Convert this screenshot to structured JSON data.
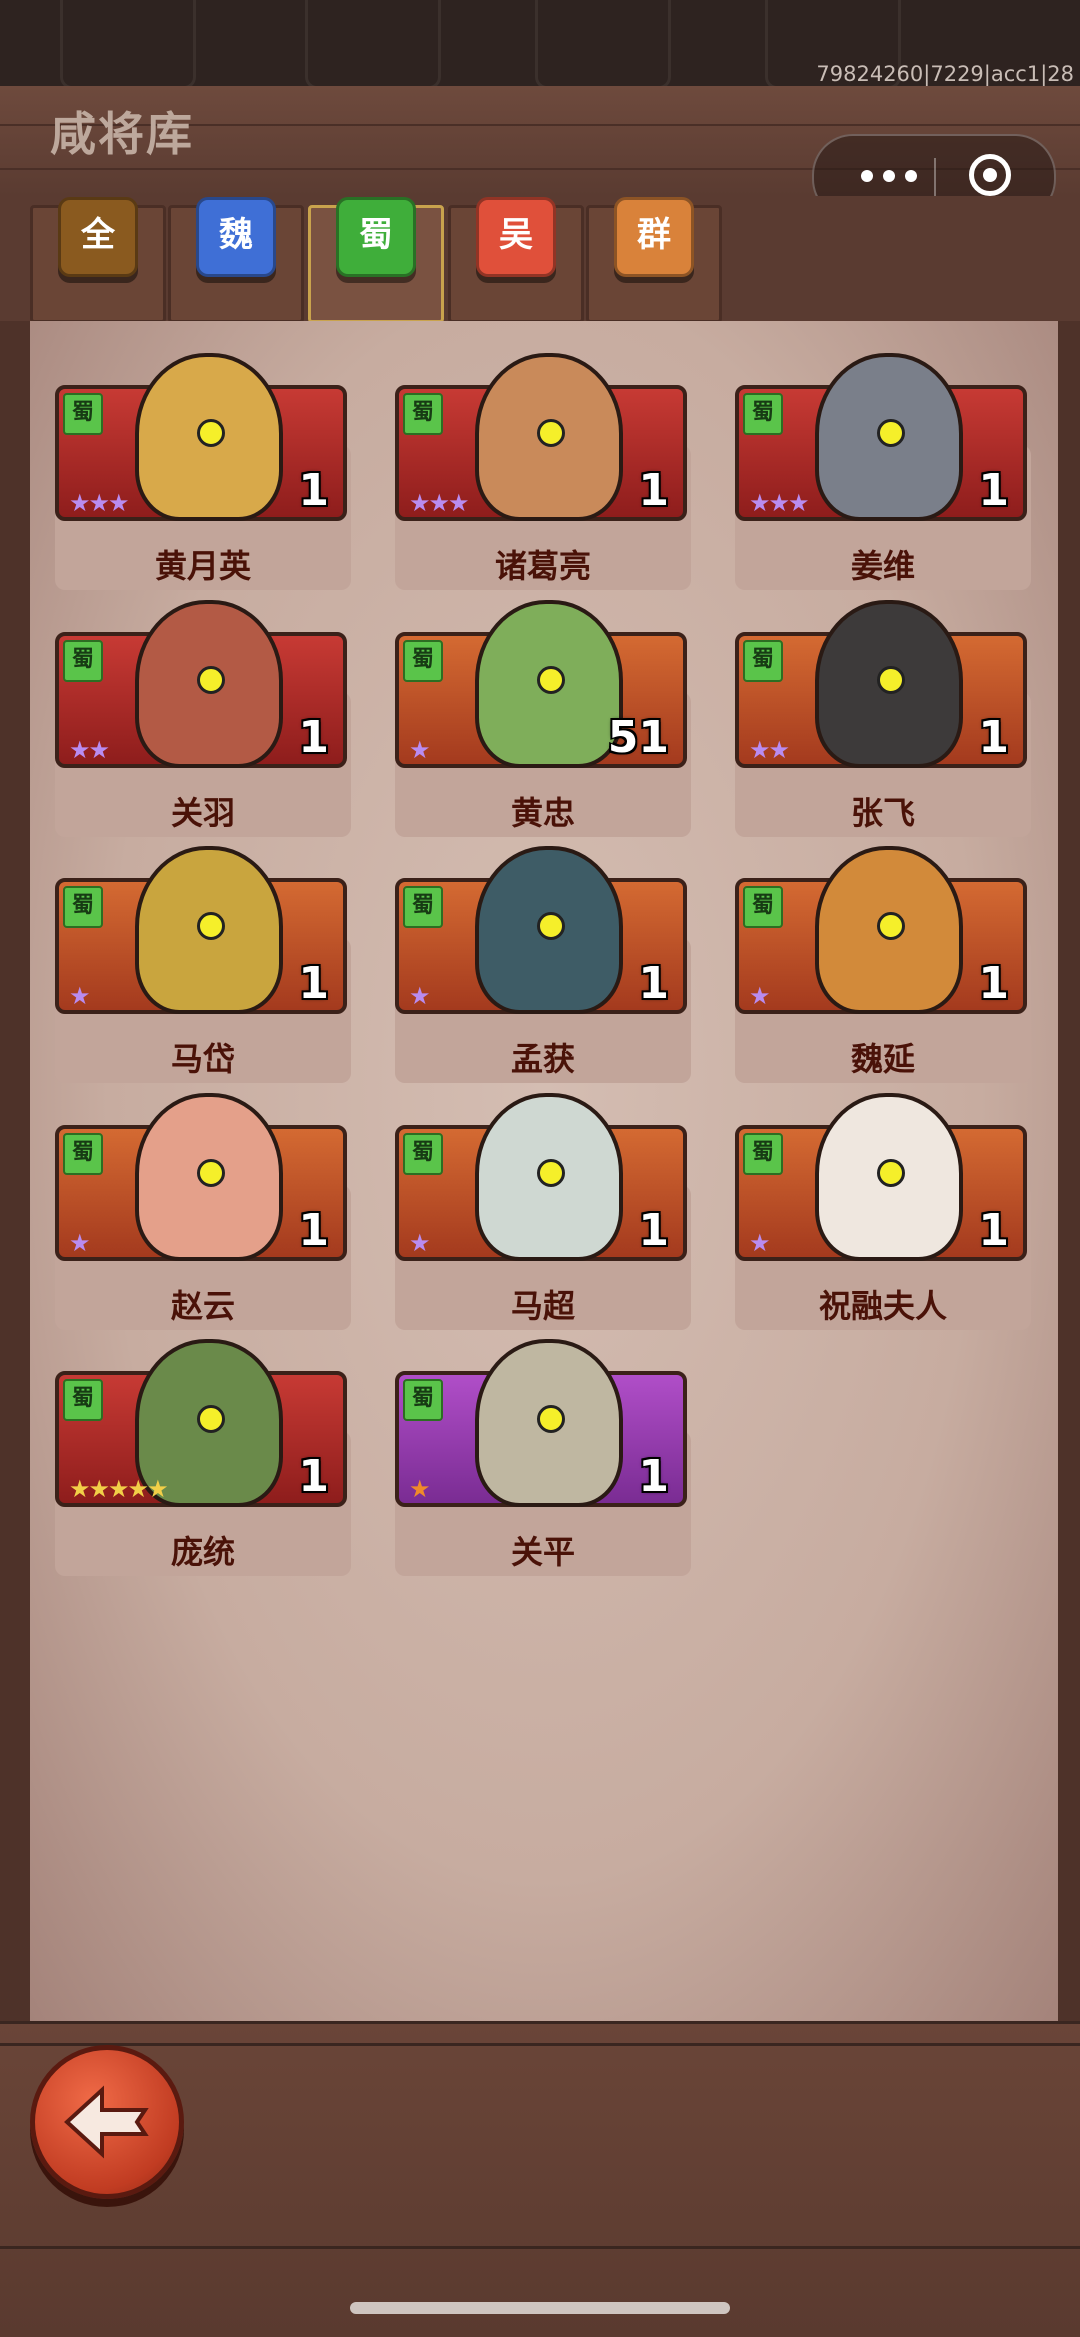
{
  "debug_text": "79824260|7229|acc1|28",
  "title": "咸将库",
  "capsule": {
    "menu_icon": "more-dots-icon",
    "close_icon": "target-icon"
  },
  "tabs": [
    {
      "label": "全",
      "color": "#8a5a1f",
      "active": false
    },
    {
      "label": "魏",
      "color": "#3f6fd6",
      "active": false
    },
    {
      "label": "蜀",
      "color": "#3fae3a",
      "active": true
    },
    {
      "label": "吴",
      "color": "#e0503a",
      "active": false
    },
    {
      "label": "群",
      "color": "#d9823a",
      "active": false
    }
  ],
  "heroes": [
    {
      "name": "黄月英",
      "faction": "蜀",
      "level": "1",
      "stars": 3,
      "star_color": "#b98cf0",
      "frame": "red"
    },
    {
      "name": "诸葛亮",
      "faction": "蜀",
      "level": "1",
      "stars": 3,
      "star_color": "#b98cf0",
      "frame": "red"
    },
    {
      "name": "姜维",
      "faction": "蜀",
      "level": "1",
      "stars": 3,
      "star_color": "#b98cf0",
      "frame": "red"
    },
    {
      "name": "关羽",
      "faction": "蜀",
      "level": "1",
      "stars": 2,
      "star_color": "#b98cf0",
      "frame": "red"
    },
    {
      "name": "黄忠",
      "faction": "蜀",
      "level": "51",
      "stars": 1,
      "star_color": "#b98cf0",
      "frame": "orange"
    },
    {
      "name": "张飞",
      "faction": "蜀",
      "level": "1",
      "stars": 2,
      "star_color": "#b98cf0",
      "frame": "orange"
    },
    {
      "name": "马岱",
      "faction": "蜀",
      "level": "1",
      "stars": 1,
      "star_color": "#b98cf0",
      "frame": "orange"
    },
    {
      "name": "孟获",
      "faction": "蜀",
      "level": "1",
      "stars": 1,
      "star_color": "#b98cf0",
      "frame": "orange"
    },
    {
      "name": "魏延",
      "faction": "蜀",
      "level": "1",
      "stars": 1,
      "star_color": "#b98cf0",
      "frame": "orange"
    },
    {
      "name": "赵云",
      "faction": "蜀",
      "level": "1",
      "stars": 1,
      "star_color": "#b98cf0",
      "frame": "orange"
    },
    {
      "name": "马超",
      "faction": "蜀",
      "level": "1",
      "stars": 1,
      "star_color": "#b98cf0",
      "frame": "orange"
    },
    {
      "name": "祝融夫人",
      "faction": "蜀",
      "level": "1",
      "stars": 1,
      "star_color": "#b98cf0",
      "frame": "orange"
    },
    {
      "name": "庞统",
      "faction": "蜀",
      "level": "1",
      "stars": 5,
      "star_color": "#f2cf48",
      "frame": "red"
    },
    {
      "name": "关平",
      "faction": "蜀",
      "level": "1",
      "stars": 1,
      "star_color": "#f08a2a",
      "frame": "purple"
    }
  ],
  "back_button": {
    "icon": "back-arrow-icon"
  }
}
